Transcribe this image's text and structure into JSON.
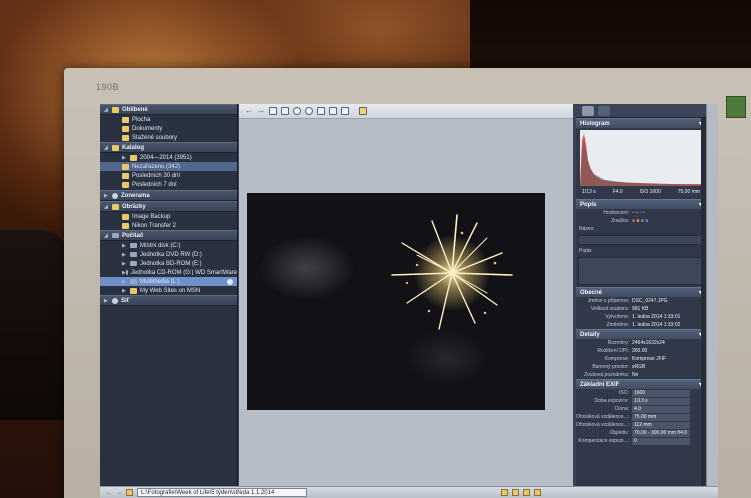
{
  "monitor": {
    "brand": "190B"
  },
  "nav": {
    "sections": [
      {
        "title": "Oblíbené",
        "items": [
          "Plocha",
          "Dokumenty",
          "Stažené soubory"
        ]
      },
      {
        "title": "Katalog",
        "items": [
          "2004—2014 (3951)",
          "Nezařazeno (342)",
          "Posledních 30 dní",
          "Posledních 7 dní"
        ]
      },
      {
        "title": "Zonerama",
        "items": []
      },
      {
        "title": "Obrázky",
        "items": [
          "Image Backup",
          "Nikon Transfer 2"
        ]
      },
      {
        "title": "Počítač",
        "items": [
          "Místní disk (C:)",
          "Jednotka DVD RW (D:)",
          "Jednotka BD-ROM (E:)",
          "Jednotka CD-ROM (G:) WD SmartWare",
          "Multimedia (L:)",
          "My Web Sites on MSN"
        ]
      },
      {
        "title": "Síť",
        "items": []
      }
    ]
  },
  "info": {
    "histogram": {
      "title": "Histogram",
      "shutter": "1/13 s",
      "aperture": "F4.0",
      "iso": "ISO 1600",
      "focal": "75.00 mm"
    },
    "popis": {
      "title": "Popis",
      "rating_label": "Hodnocení:",
      "marks_label": "Značka:",
      "name_label": "Název:",
      "desc_label": "Popis"
    },
    "obecne": {
      "title": "Obecné",
      "rows": [
        {
          "k": "Jméno s příponou:",
          "v": "DSC_0247.JPG"
        },
        {
          "k": "Velikost souboru:",
          "v": "991 KB"
        },
        {
          "k": "Vytvořeno:",
          "v": "1. ledna 2014 1:33:01"
        },
        {
          "k": "Změněno:",
          "v": "1. ledna 2014 1:33:02"
        }
      ]
    },
    "detaily": {
      "title": "Detaily",
      "rows": [
        {
          "k": "Rozměry:",
          "v": "2464x1632x24"
        },
        {
          "k": "Rozlišení DPI:",
          "v": "300.00"
        },
        {
          "k": "Komprese:",
          "v": "Komprese JFIF"
        },
        {
          "k": "Barevný prostor:",
          "v": "sRGB"
        },
        {
          "k": "Zvuková poznámka:",
          "v": "Ne"
        }
      ]
    },
    "exif": {
      "title": "Základní EXIF",
      "rows": [
        {
          "k": "ISO:",
          "v": "1600"
        },
        {
          "k": "Doba expozice:",
          "v": "1/13 s"
        },
        {
          "k": "Clona:",
          "v": "4.0"
        },
        {
          "k": "Ohnisková vzdálenos...:",
          "v": "75.00 mm"
        },
        {
          "k": "Ohnisková vzdálenos...:",
          "v": "112 mm"
        },
        {
          "k": "Objektiv:",
          "v": "70.00 - 300.00 mm f/4.0"
        },
        {
          "k": "Kompenzace expozi...:",
          "v": "0"
        }
      ]
    }
  },
  "status": {
    "path": "L:\\Fotografie\\Week of Life\\5 týden\\středa 1.1.2014"
  },
  "colors": {
    "nav_bg": "#2a3242",
    "selection": "#52668e",
    "highlight": "#6e8fc7",
    "folder": "#e9c86a"
  }
}
